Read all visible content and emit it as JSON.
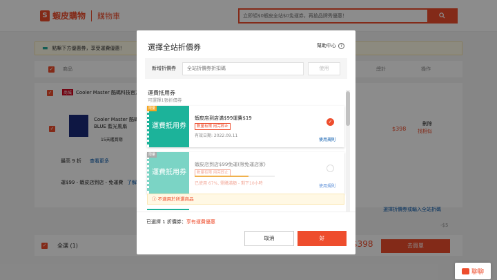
{
  "header": {
    "logo_mark": "S",
    "brand": "蝦皮購物",
    "page": "購物車",
    "search_placeholder": "立即領$0蝦皮全站$0免運券，再搶品牌秀優惠！",
    "search_icon": "magnifier"
  },
  "background": {
    "notice": "點擊下方優惠券，享受運費優惠！",
    "col_product": "商品",
    "col_total": "總計",
    "col_action": "操作",
    "shop_badge": "商城",
    "shop_name": "Cooler Master 酷碼科技官方",
    "product_name": "Cooler Master 酷碼",
    "product_variant": "BLUE 藍光風扇",
    "product_badge": "15天鑑賞期",
    "price": "$398",
    "delete": "刪除",
    "find_similar": "找相似",
    "promo": "最高 9 折",
    "more": "查看更多",
    "shipping": "運$99 - 蝦皮店到店 - 免運費",
    "shipping_link": "了解",
    "voucher_link": "選擇折價券或輸入全站折碼",
    "discount": "-$5",
    "select_all": "全選 (1)",
    "grand_total": "$398",
    "checkout": "去買單",
    "chat": "聊聊"
  },
  "modal": {
    "title": "選擇全站折價券",
    "help": "幫助中心",
    "code_label": "新增折價券",
    "code_placeholder": "全站折價券折扣碼",
    "code_button": "使用",
    "section_title": "運費抵用券",
    "section_sub": "可選擇1張折價券",
    "coupons": [
      {
        "tag": "限量",
        "stub": "運費抵用券",
        "name": "蝦皮店到店滿$99運費$19",
        "pill": "數量有限 用完即止",
        "expiry": "有效日期: 2022.09.11",
        "terms": "使用規則",
        "selected": true
      },
      {
        "tag": "限量",
        "stub": "運費抵用券",
        "name": "蝦皮店到店$99免運(限免運店家)",
        "pill": "數量有限 用完即止",
        "usage": "已使用 67%, 需購滿額 - 剩下10小時",
        "usage_progress": 0.67,
        "terms": "使用規則",
        "selected": false
      }
    ],
    "warning": "不適用於所選商品",
    "selected_prefix": "已選擇 1 折價券：",
    "selected_value": "享有運費優惠",
    "cancel": "取消",
    "ok": "好"
  },
  "colors": {
    "brand": "#ee4d2d",
    "teal": "#1cb39a"
  }
}
